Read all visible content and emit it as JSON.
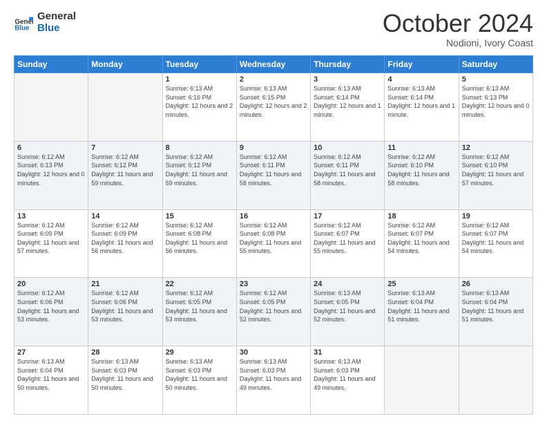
{
  "header": {
    "logo_text_general": "General",
    "logo_text_blue": "Blue",
    "month": "October 2024",
    "location": "Nodioni, Ivory Coast"
  },
  "days_of_week": [
    "Sunday",
    "Monday",
    "Tuesday",
    "Wednesday",
    "Thursday",
    "Friday",
    "Saturday"
  ],
  "weeks": [
    [
      {
        "day": null
      },
      {
        "day": null
      },
      {
        "day": "1",
        "sunrise": "6:13 AM",
        "sunset": "6:16 PM",
        "daylight": "12 hours and 2 minutes."
      },
      {
        "day": "2",
        "sunrise": "6:13 AM",
        "sunset": "6:15 PM",
        "daylight": "12 hours and 2 minutes."
      },
      {
        "day": "3",
        "sunrise": "6:13 AM",
        "sunset": "6:14 PM",
        "daylight": "12 hours and 1 minute."
      },
      {
        "day": "4",
        "sunrise": "6:13 AM",
        "sunset": "6:14 PM",
        "daylight": "12 hours and 1 minute."
      },
      {
        "day": "5",
        "sunrise": "6:13 AM",
        "sunset": "6:13 PM",
        "daylight": "12 hours and 0 minutes."
      }
    ],
    [
      {
        "day": "6",
        "sunrise": "6:12 AM",
        "sunset": "6:13 PM",
        "daylight": "12 hours and 0 minutes."
      },
      {
        "day": "7",
        "sunrise": "6:12 AM",
        "sunset": "6:12 PM",
        "daylight": "11 hours and 59 minutes."
      },
      {
        "day": "8",
        "sunrise": "6:12 AM",
        "sunset": "6:12 PM",
        "daylight": "11 hours and 59 minutes."
      },
      {
        "day": "9",
        "sunrise": "6:12 AM",
        "sunset": "6:11 PM",
        "daylight": "11 hours and 58 minutes."
      },
      {
        "day": "10",
        "sunrise": "6:12 AM",
        "sunset": "6:11 PM",
        "daylight": "11 hours and 58 minutes."
      },
      {
        "day": "11",
        "sunrise": "6:12 AM",
        "sunset": "6:10 PM",
        "daylight": "11 hours and 58 minutes."
      },
      {
        "day": "12",
        "sunrise": "6:12 AM",
        "sunset": "6:10 PM",
        "daylight": "11 hours and 57 minutes."
      }
    ],
    [
      {
        "day": "13",
        "sunrise": "6:12 AM",
        "sunset": "6:09 PM",
        "daylight": "11 hours and 57 minutes."
      },
      {
        "day": "14",
        "sunrise": "6:12 AM",
        "sunset": "6:09 PM",
        "daylight": "11 hours and 56 minutes."
      },
      {
        "day": "15",
        "sunrise": "6:12 AM",
        "sunset": "6:08 PM",
        "daylight": "11 hours and 56 minutes."
      },
      {
        "day": "16",
        "sunrise": "6:12 AM",
        "sunset": "6:08 PM",
        "daylight": "11 hours and 55 minutes."
      },
      {
        "day": "17",
        "sunrise": "6:12 AM",
        "sunset": "6:07 PM",
        "daylight": "11 hours and 55 minutes."
      },
      {
        "day": "18",
        "sunrise": "6:12 AM",
        "sunset": "6:07 PM",
        "daylight": "11 hours and 54 minutes."
      },
      {
        "day": "19",
        "sunrise": "6:12 AM",
        "sunset": "6:07 PM",
        "daylight": "11 hours and 54 minutes."
      }
    ],
    [
      {
        "day": "20",
        "sunrise": "6:12 AM",
        "sunset": "6:06 PM",
        "daylight": "11 hours and 53 minutes."
      },
      {
        "day": "21",
        "sunrise": "6:12 AM",
        "sunset": "6:06 PM",
        "daylight": "11 hours and 53 minutes."
      },
      {
        "day": "22",
        "sunrise": "6:12 AM",
        "sunset": "6:05 PM",
        "daylight": "11 hours and 53 minutes."
      },
      {
        "day": "23",
        "sunrise": "6:12 AM",
        "sunset": "6:05 PM",
        "daylight": "11 hours and 52 minutes."
      },
      {
        "day": "24",
        "sunrise": "6:13 AM",
        "sunset": "6:05 PM",
        "daylight": "11 hours and 52 minutes."
      },
      {
        "day": "25",
        "sunrise": "6:13 AM",
        "sunset": "6:04 PM",
        "daylight": "11 hours and 51 minutes."
      },
      {
        "day": "26",
        "sunrise": "6:13 AM",
        "sunset": "6:04 PM",
        "daylight": "11 hours and 51 minutes."
      }
    ],
    [
      {
        "day": "27",
        "sunrise": "6:13 AM",
        "sunset": "6:04 PM",
        "daylight": "11 hours and 50 minutes."
      },
      {
        "day": "28",
        "sunrise": "6:13 AM",
        "sunset": "6:03 PM",
        "daylight": "11 hours and 50 minutes."
      },
      {
        "day": "29",
        "sunrise": "6:13 AM",
        "sunset": "6:03 PM",
        "daylight": "11 hours and 50 minutes."
      },
      {
        "day": "30",
        "sunrise": "6:13 AM",
        "sunset": "6:03 PM",
        "daylight": "11 hours and 49 minutes."
      },
      {
        "day": "31",
        "sunrise": "6:13 AM",
        "sunset": "6:03 PM",
        "daylight": "11 hours and 49 minutes."
      },
      {
        "day": null
      },
      {
        "day": null
      }
    ]
  ],
  "labels": {
    "sunrise": "Sunrise:",
    "sunset": "Sunset:",
    "daylight": "Daylight:"
  },
  "colors": {
    "header_bg": "#2d7dd2",
    "row_alt": "#eaf0f8"
  }
}
